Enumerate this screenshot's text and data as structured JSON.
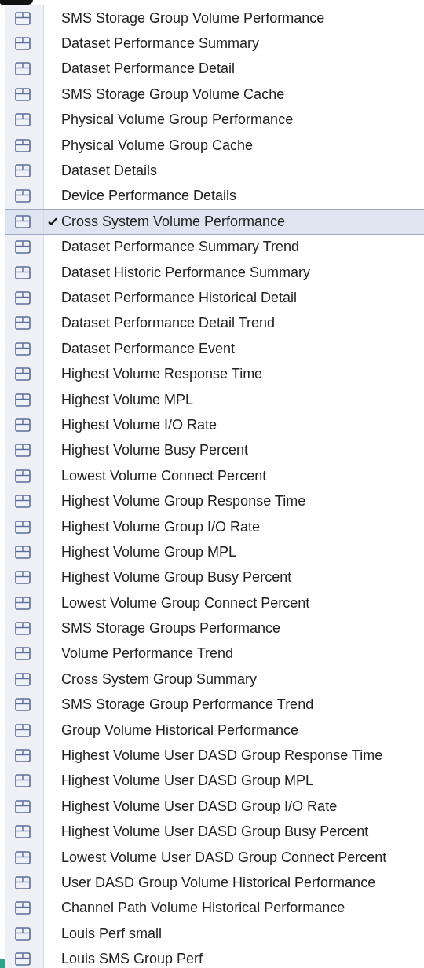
{
  "menu": {
    "items": [
      {
        "label": "SMS Storage Group Volume Performance",
        "selected": false,
        "checked": false
      },
      {
        "label": "Dataset Performance Summary",
        "selected": false,
        "checked": false
      },
      {
        "label": "Dataset Performance Detail",
        "selected": false,
        "checked": false
      },
      {
        "label": "SMS Storage Group Volume Cache",
        "selected": false,
        "checked": false
      },
      {
        "label": "Physical Volume Group Performance",
        "selected": false,
        "checked": false
      },
      {
        "label": "Physical Volume Group Cache",
        "selected": false,
        "checked": false
      },
      {
        "label": "Dataset Details",
        "selected": false,
        "checked": false
      },
      {
        "label": "Device Performance Details",
        "selected": false,
        "checked": false
      },
      {
        "label": "Cross System Volume Performance",
        "selected": true,
        "checked": true
      },
      {
        "label": "Dataset Performance Summary Trend",
        "selected": false,
        "checked": false
      },
      {
        "label": "Dataset Historic Performance Summary",
        "selected": false,
        "checked": false
      },
      {
        "label": "Dataset Performance Historical Detail",
        "selected": false,
        "checked": false
      },
      {
        "label": "Dataset Performance Detail Trend",
        "selected": false,
        "checked": false
      },
      {
        "label": "Dataset Performance Event",
        "selected": false,
        "checked": false
      },
      {
        "label": "Highest Volume Response Time",
        "selected": false,
        "checked": false
      },
      {
        "label": "Highest Volume MPL",
        "selected": false,
        "checked": false
      },
      {
        "label": "Highest Volume I/O Rate",
        "selected": false,
        "checked": false
      },
      {
        "label": "Highest Volume Busy Percent",
        "selected": false,
        "checked": false
      },
      {
        "label": "Lowest Volume Connect Percent",
        "selected": false,
        "checked": false
      },
      {
        "label": "Highest Volume Group Response Time",
        "selected": false,
        "checked": false
      },
      {
        "label": "Highest Volume Group I/O Rate",
        "selected": false,
        "checked": false
      },
      {
        "label": "Highest Volume Group MPL",
        "selected": false,
        "checked": false
      },
      {
        "label": "Highest Volume Group Busy Percent",
        "selected": false,
        "checked": false
      },
      {
        "label": "Lowest Volume Group Connect Percent",
        "selected": false,
        "checked": false
      },
      {
        "label": "SMS Storage Groups Performance",
        "selected": false,
        "checked": false
      },
      {
        "label": "Volume Performance Trend",
        "selected": false,
        "checked": false
      },
      {
        "label": "Cross System Group Summary",
        "selected": false,
        "checked": false
      },
      {
        "label": "SMS Storage Group Performance Trend",
        "selected": false,
        "checked": false
      },
      {
        "label": "Group Volume Historical Performance",
        "selected": false,
        "checked": false
      },
      {
        "label": "Highest Volume User DASD Group Response Time",
        "selected": false,
        "checked": false
      },
      {
        "label": "Highest Volume User DASD Group MPL",
        "selected": false,
        "checked": false
      },
      {
        "label": "Highest Volume User DASD Group I/O Rate",
        "selected": false,
        "checked": false
      },
      {
        "label": "Highest Volume User DASD Group Busy Percent",
        "selected": false,
        "checked": false
      },
      {
        "label": "Lowest Volume User DASD Group Connect Percent",
        "selected": false,
        "checked": false
      },
      {
        "label": "User DASD Group Volume Historical Performance",
        "selected": false,
        "checked": false
      },
      {
        "label": "Channel Path Volume Historical Performance",
        "selected": false,
        "checked": false
      },
      {
        "label": "Louis Perf small",
        "selected": false,
        "checked": false
      },
      {
        "label": "Louis SMS Group Perf",
        "selected": false,
        "checked": false
      }
    ]
  }
}
